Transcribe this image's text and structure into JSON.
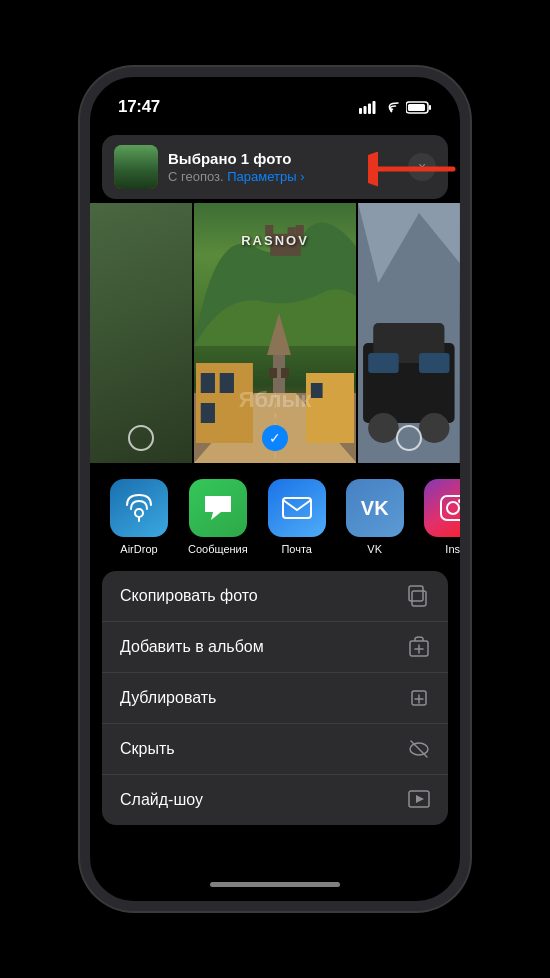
{
  "statusBar": {
    "time": "17:47",
    "moonIcon": "🌙"
  },
  "shareHeader": {
    "title": "Выбрано 1 фото",
    "subtitle": "С геопоз. ",
    "paramsLabel": "Параметры ›",
    "closeLabel": "×"
  },
  "photos": {
    "centerText": "RASNOV",
    "watermark": "Яблык"
  },
  "shareApps": [
    {
      "id": "airdrop",
      "label": "AirDrop",
      "type": "airdrop"
    },
    {
      "id": "messages",
      "label": "Сообщения",
      "type": "messages"
    },
    {
      "id": "mail",
      "label": "Почта",
      "type": "mail"
    },
    {
      "id": "vk",
      "label": "VK",
      "type": "vk"
    },
    {
      "id": "instagram",
      "label": "Ins",
      "type": "instagram"
    }
  ],
  "actions": [
    {
      "id": "copy-photo",
      "label": "Скопировать фото",
      "icon": "⧉"
    },
    {
      "id": "add-album",
      "label": "Добавить в альбом",
      "icon": "⊕"
    },
    {
      "id": "duplicate",
      "label": "Дублировать",
      "icon": "⊞"
    },
    {
      "id": "hide",
      "label": "Скрыть",
      "icon": "⊘"
    },
    {
      "id": "slideshow",
      "label": "Слайд-шоу",
      "icon": "▶"
    }
  ]
}
